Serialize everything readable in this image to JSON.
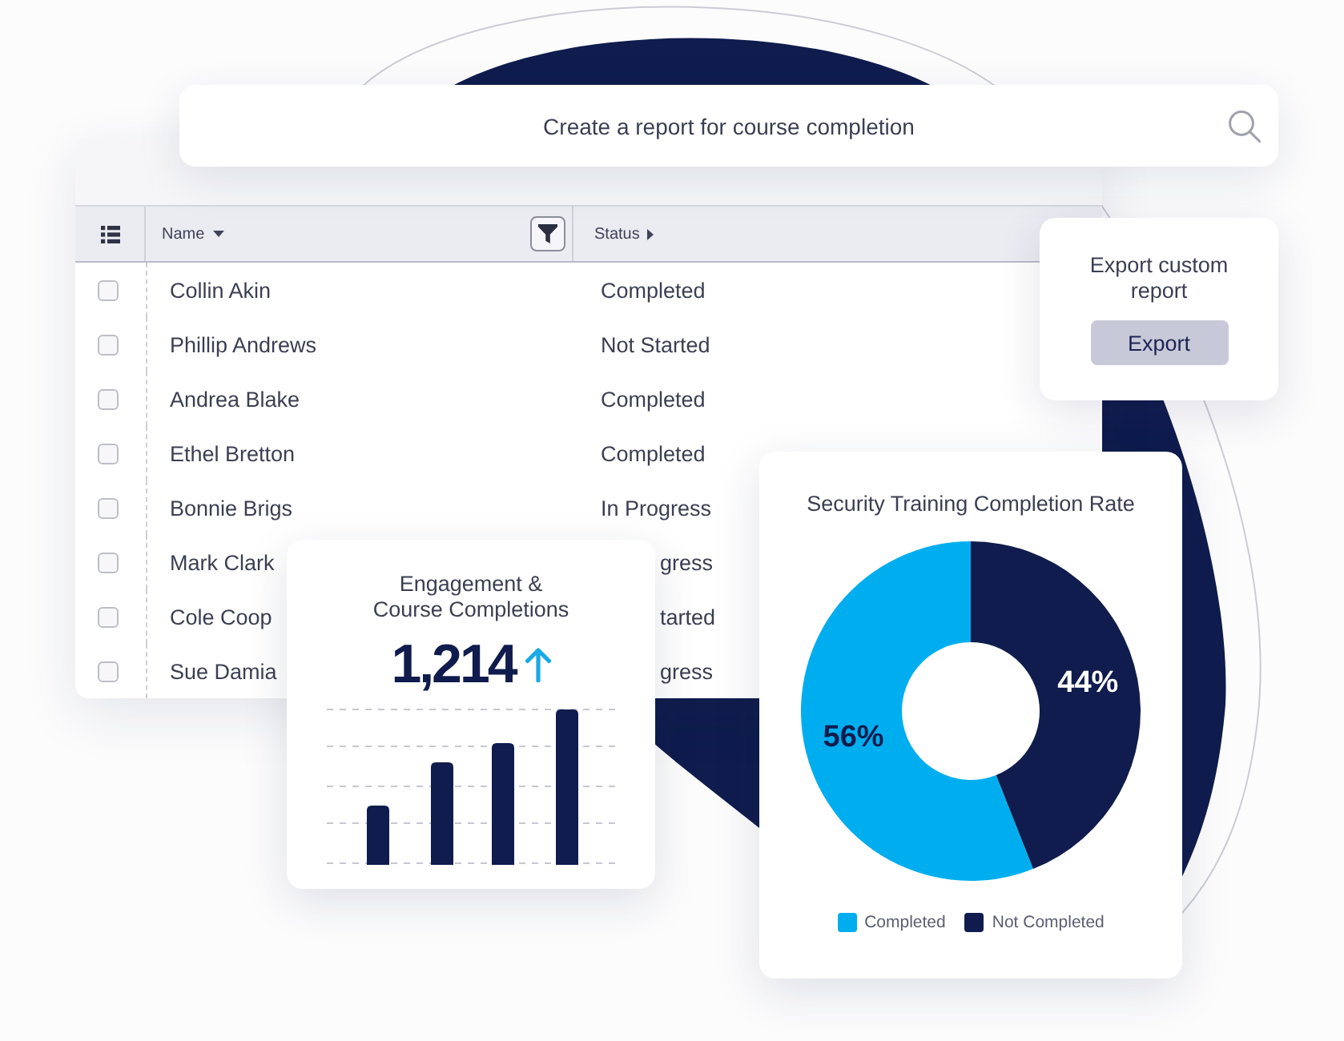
{
  "search": {
    "value": "Create a report for course completion"
  },
  "table": {
    "columns": [
      {
        "label": "Name",
        "sorted": true,
        "filter": true
      },
      {
        "label": "Status",
        "sorted": false,
        "filter": false
      }
    ],
    "rows": [
      {
        "name": "Collin Akin",
        "status": "Completed",
        "checked": false
      },
      {
        "name": "Phillip Andrews",
        "status": "Not Started",
        "checked": false
      },
      {
        "name": "Andrea Blake",
        "status": "Completed",
        "checked": false
      },
      {
        "name": "Ethel Bretton",
        "status": "Completed",
        "checked": false
      },
      {
        "name": "Bonnie Brigs",
        "status": "In Progress",
        "checked": false
      }
    ],
    "rows_partly_hidden": [
      {
        "name": "Mark Clark",
        "status": "gress",
        "checked": false
      },
      {
        "name": "Cole Coop",
        "status": "tarted",
        "checked": false
      },
      {
        "name": "Sue Damia",
        "status": "gress",
        "checked": false
      }
    ]
  },
  "export_card": {
    "title": "Export custom\nreport",
    "button": "Export"
  },
  "engagement_card": {
    "title": "Engagement &\nCourse Completions",
    "value": "1,214",
    "rising": true
  },
  "completion_card": {
    "chart_data": {
      "type": "donut",
      "title": "Security Training Completion Rate",
      "categories": [
        "Completed",
        "Not Completed"
      ],
      "values": [
        56,
        44
      ],
      "value_labels": [
        "56%",
        "44%"
      ]
    },
    "legend": [
      {
        "color": "#00aeef"
      },
      {
        "color": "#0f1c4d"
      }
    ]
  }
}
